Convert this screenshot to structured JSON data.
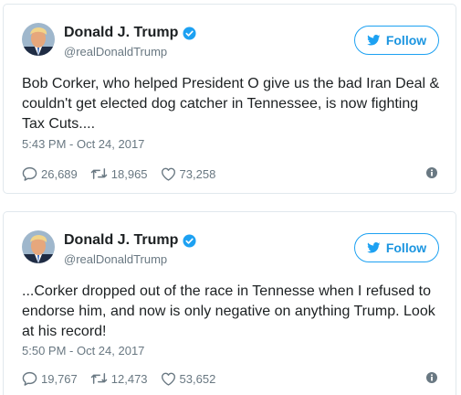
{
  "tweets": [
    {
      "display_name": "Donald J. Trump",
      "handle": "@realDonaldTrump",
      "follow_label": "Follow",
      "text": "Bob Corker, who helped President O give us the bad Iran Deal & couldn't get elected dog catcher in Tennessee, is now fighting Tax Cuts....",
      "timestamp": "5:43 PM - Oct 24, 2017",
      "replies": "26,689",
      "retweets": "18,965",
      "likes": "73,258"
    },
    {
      "display_name": "Donald J. Trump",
      "handle": "@realDonaldTrump",
      "follow_label": "Follow",
      "text": "...Corker dropped out of the race in Tennesse when I refused to endorse him, and now is only negative on anything Trump. Look at his record!",
      "timestamp": "5:50 PM - Oct 24, 2017",
      "replies": "19,767",
      "retweets": "12,473",
      "likes": "53,652"
    }
  ],
  "icons": {
    "verified": "verified-badge-icon",
    "bird": "twitter-bird-icon",
    "reply": "reply-icon",
    "retweet": "retweet-icon",
    "like": "heart-icon",
    "info": "info-icon"
  },
  "colors": {
    "accent": "#1da1f2",
    "text": "#1c2022",
    "muted": "#697882",
    "border": "#e1e8ed"
  }
}
